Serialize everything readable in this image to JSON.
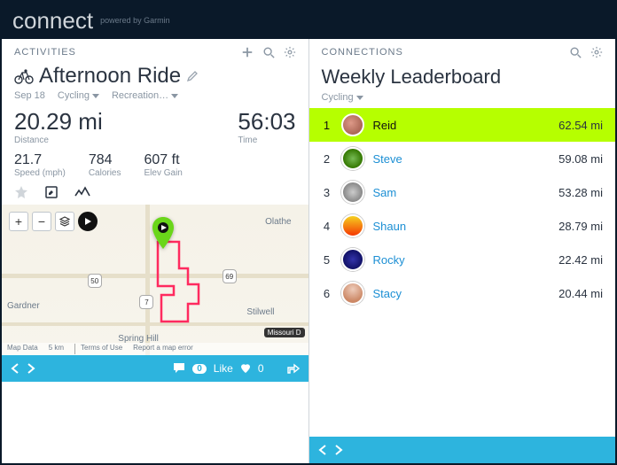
{
  "brand": {
    "name": "connect",
    "tagline": "powered by Garmin"
  },
  "activities": {
    "panel_label": "ACTIVITIES",
    "title": "Afternoon Ride",
    "date": "Sep 18",
    "type": "Cycling",
    "subtype": "Recreation…",
    "distance": {
      "value": "20.29 mi",
      "label": "Distance"
    },
    "time": {
      "value": "56:03",
      "label": "Time"
    },
    "speed": {
      "value": "21.7",
      "label": "Speed (mph)"
    },
    "calories": {
      "value": "784",
      "label": "Calories"
    },
    "elev": {
      "value": "607 ft",
      "label": "Elev Gain"
    },
    "map": {
      "cities": {
        "gardner": "Gardner",
        "olathe": "Olathe",
        "spring": "Spring Hill",
        "stilwell": "Stilwell"
      },
      "shields": {
        "us50": "50",
        "k7": "7",
        "us69": "69"
      },
      "state_badge": "Missouri D",
      "foot": {
        "mapdata": "Map Data",
        "scale": "5 km",
        "terms": "Terms of Use",
        "report": "Report a map error"
      }
    },
    "footer": {
      "badge": "0",
      "like": "Like",
      "likes": "0"
    }
  },
  "connections": {
    "panel_label": "CONNECTIONS",
    "title": "Weekly Leaderboard",
    "filter": "Cycling",
    "rows": [
      {
        "rank": "1",
        "name": "Reid",
        "dist": "62.54 mi"
      },
      {
        "rank": "2",
        "name": "Steve",
        "dist": "59.08 mi"
      },
      {
        "rank": "3",
        "name": "Sam",
        "dist": "53.28 mi"
      },
      {
        "rank": "4",
        "name": "Shaun",
        "dist": "28.79 mi"
      },
      {
        "rank": "5",
        "name": "Rocky",
        "dist": "22.42 mi"
      },
      {
        "rank": "6",
        "name": "Stacy",
        "dist": "20.44 mi"
      }
    ]
  }
}
